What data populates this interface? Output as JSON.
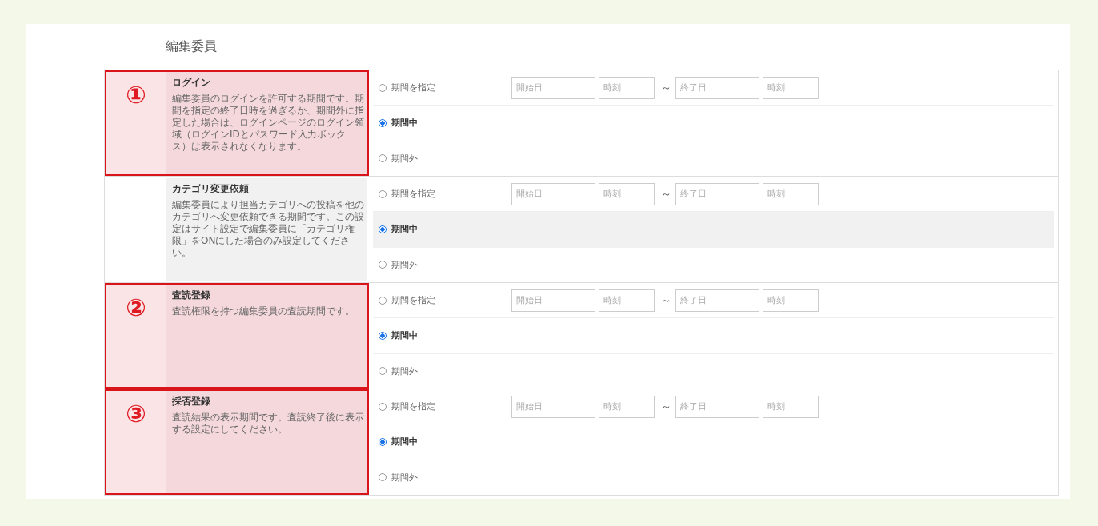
{
  "page_title": "編集委員",
  "sections": [
    {
      "annotated": true,
      "marker": "①",
      "title": "ログイン",
      "description": "編集委員のログインを許可する期間です。期間を指定の終了日時を過ぎるか、期間外に指定した場合は、ログインページのログイン領域（ログインIDとパスワード入力ボックス）は表示されなくなります。",
      "options": [
        {
          "kind": "range",
          "label": "期間を指定",
          "selected": false,
          "hovered": false,
          "start_date": {
            "placeholder": "開始日"
          },
          "start_time": {
            "placeholder": "時刻"
          },
          "separator": "～",
          "end_date": {
            "placeholder": "終了日"
          },
          "end_time": {
            "placeholder": "時刻"
          }
        },
        {
          "kind": "plain",
          "label": "期間中",
          "selected": true,
          "hovered": false
        },
        {
          "kind": "plain",
          "label": "期間外",
          "selected": false,
          "hovered": false
        }
      ]
    },
    {
      "annotated": false,
      "title": "カテゴリ変更依頼",
      "description": "編集委員により担当カテゴリへの投稿を他のカテゴリへ変更依頼できる期間です。この設定はサイト設定で編集委員に「カテゴリ権限」をONにした場合のみ設定してください。",
      "options": [
        {
          "kind": "range",
          "label": "期間を指定",
          "selected": false,
          "hovered": false,
          "start_date": {
            "placeholder": "開始日"
          },
          "start_time": {
            "placeholder": "時刻"
          },
          "separator": "～",
          "end_date": {
            "placeholder": "終了日"
          },
          "end_time": {
            "placeholder": "時刻"
          }
        },
        {
          "kind": "plain",
          "label": "期間中",
          "selected": true,
          "hovered": true
        },
        {
          "kind": "plain",
          "label": "期間外",
          "selected": false,
          "hovered": false
        }
      ]
    },
    {
      "annotated": true,
      "marker": "②",
      "title": "査読登録",
      "description": "査読権限を持つ編集委員の査読期間です。",
      "options": [
        {
          "kind": "range",
          "label": "期間を指定",
          "selected": false,
          "hovered": false,
          "start_date": {
            "placeholder": "開始日"
          },
          "start_time": {
            "placeholder": "時刻"
          },
          "separator": "～",
          "end_date": {
            "placeholder": "終了日"
          },
          "end_time": {
            "placeholder": "時刻"
          }
        },
        {
          "kind": "plain",
          "label": "期間中",
          "selected": true,
          "hovered": false
        },
        {
          "kind": "plain",
          "label": "期間外",
          "selected": false,
          "hovered": false
        }
      ]
    },
    {
      "annotated": true,
      "marker": "③",
      "title": "採否登録",
      "description": "査読結果の表示期間です。査読終了後に表示する設定にしてください。",
      "options": [
        {
          "kind": "range",
          "label": "期間を指定",
          "selected": false,
          "hovered": false,
          "start_date": {
            "placeholder": "開始日"
          },
          "start_time": {
            "placeholder": "時刻"
          },
          "separator": "～",
          "end_date": {
            "placeholder": "終了日"
          },
          "end_time": {
            "placeholder": "時刻"
          }
        },
        {
          "kind": "plain",
          "label": "期間中",
          "selected": true,
          "hovered": false
        },
        {
          "kind": "plain",
          "label": "期間外",
          "selected": false,
          "hovered": false
        }
      ]
    }
  ]
}
